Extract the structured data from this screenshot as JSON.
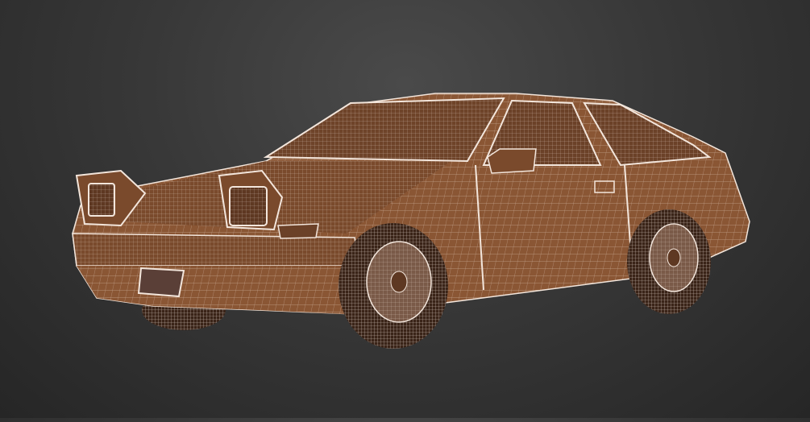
{
  "scene": {
    "subject": "car-wireframe-render",
    "colors": {
      "body": "#8a5634",
      "body_dark": "#5e3822",
      "wire": "#f3e6dc",
      "tire": "#3a2418",
      "plate": "#5a3f37",
      "background_top": "#4a4a4a",
      "background_bottom": "#262626"
    }
  }
}
